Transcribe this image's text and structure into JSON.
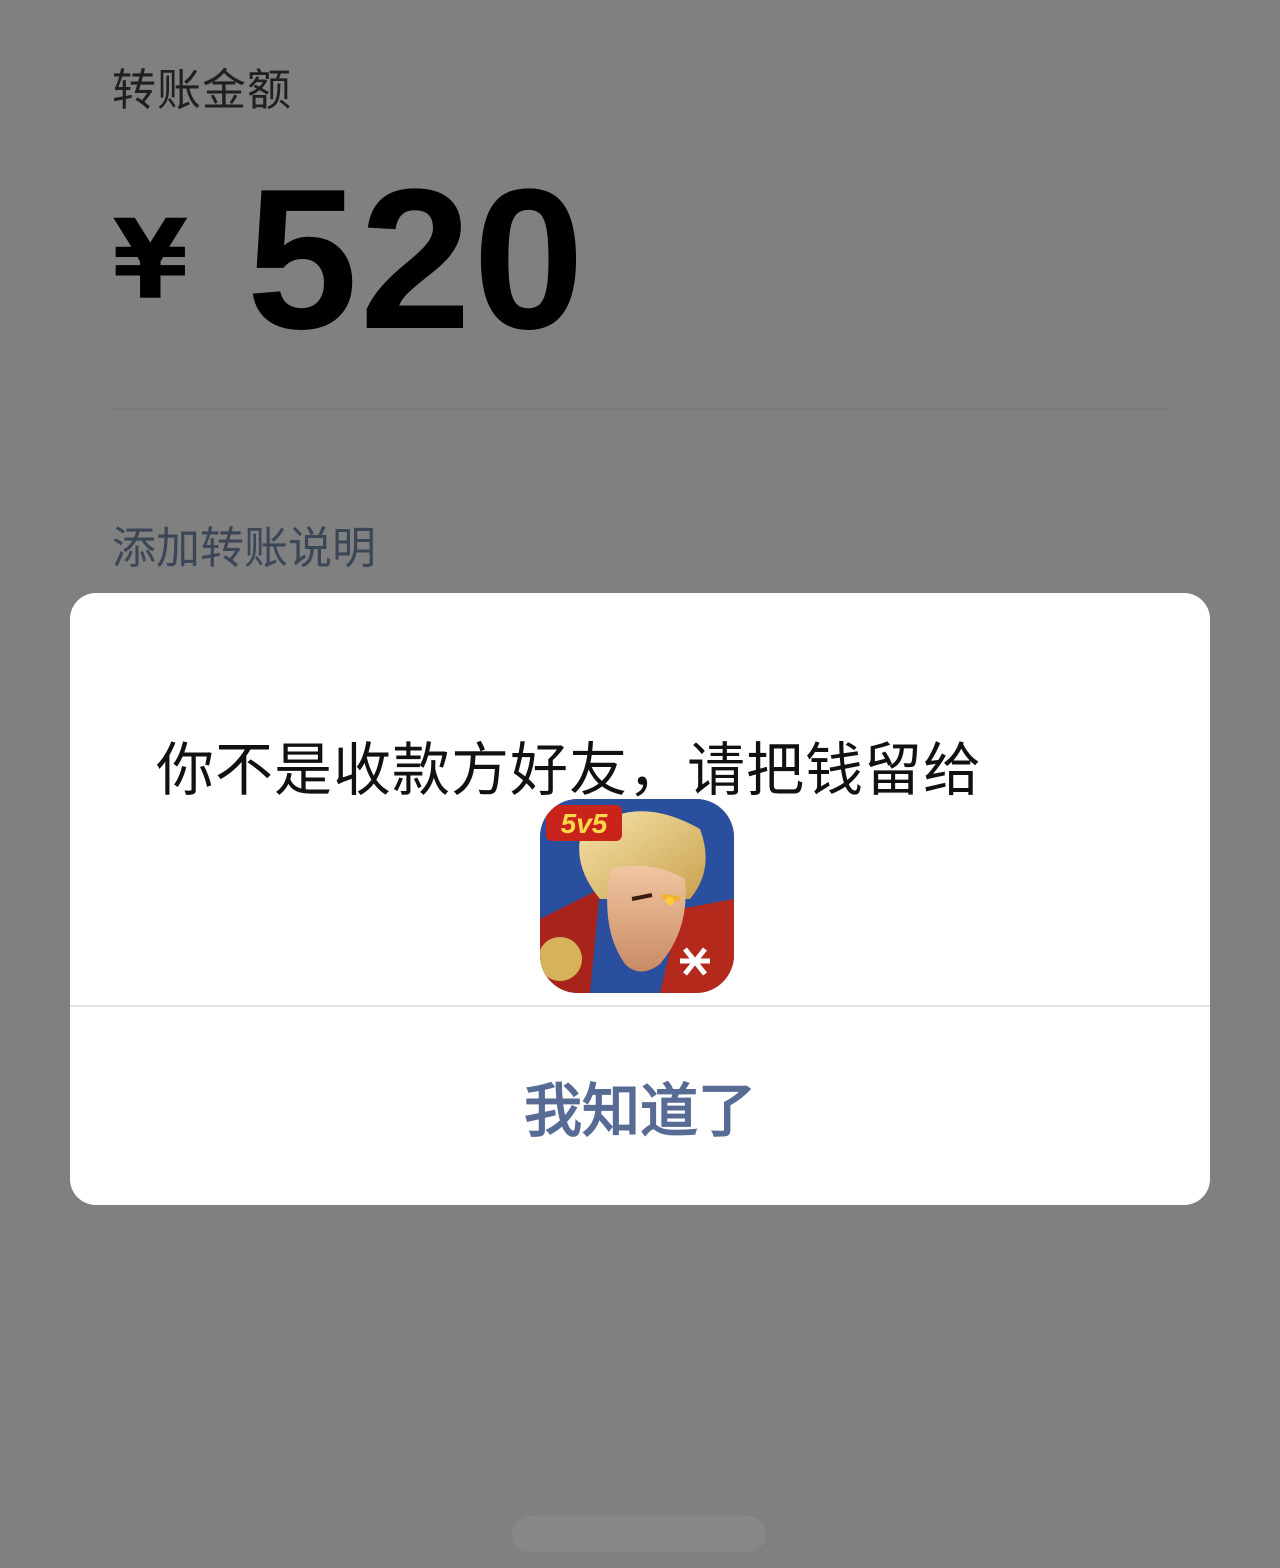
{
  "transfer": {
    "amount_label": "转账金额",
    "currency_symbol": "¥",
    "amount": "520",
    "remark_link": "添加转账说明"
  },
  "dialog": {
    "message": "你不是收款方好友，请把钱留给",
    "icon_badge": "5v5",
    "icon_name": "game-app-icon",
    "confirm_label": "我知道了"
  },
  "colors": {
    "overlay_background": "#808080",
    "dialog_background": "#ffffff",
    "link_color": "#576b95",
    "remark_color": "#3b4657"
  }
}
